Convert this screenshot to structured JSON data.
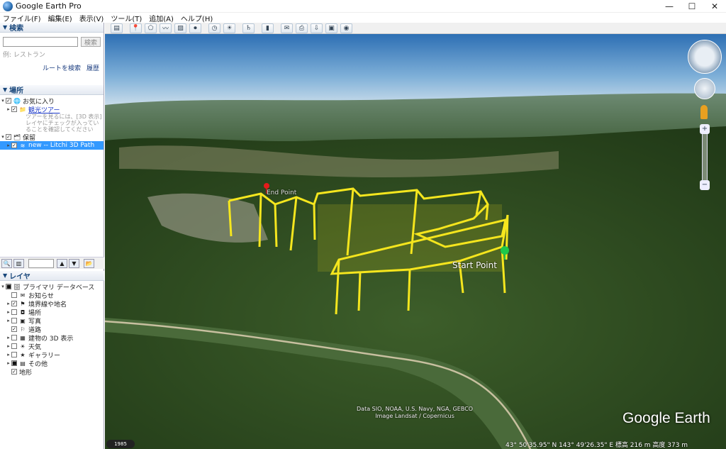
{
  "window": {
    "title": "Google Earth Pro"
  },
  "menu": [
    "ファイル(F)",
    "編集(E)",
    "表示(V)",
    "ツール(T)",
    "追加(A)",
    "ヘルプ(H)"
  ],
  "search": {
    "header": "検索",
    "input_value": "",
    "button": "検索",
    "placeholder": "例: レストラン",
    "route_link": "ルートを検索",
    "history_link": "履歴"
  },
  "places": {
    "header": "場所",
    "items": [
      {
        "label": "お気に入り",
        "checked": true
      },
      {
        "label": "観光ツアー",
        "checked": true
      },
      {
        "label": "保留",
        "checked": true
      },
      {
        "label": "new -- Litchi 3D Path",
        "checked": true
      }
    ],
    "note": "ツアーを見るには、[3D 表示] レイヤにチェックが入っていることを確認してください"
  },
  "layers": {
    "header": "レイヤ",
    "items": [
      {
        "label": "プライマリ データベース",
        "checked": true
      },
      {
        "label": "お知らせ",
        "checked": false
      },
      {
        "label": "境界線や地名",
        "checked": true
      },
      {
        "label": "場所",
        "checked": false
      },
      {
        "label": "写真",
        "checked": false
      },
      {
        "label": "道路",
        "checked": true
      },
      {
        "label": "建物の 3D 表示",
        "checked": false
      },
      {
        "label": "天気",
        "checked": false
      },
      {
        "label": "ギャラリー",
        "checked": false
      },
      {
        "label": "その他",
        "checked": false
      },
      {
        "label": "地形",
        "checked": true
      }
    ]
  },
  "map": {
    "start_label": "Start Point",
    "end_label": "End Point",
    "attribution_1": "Data SIO, NOAA, U.S. Navy, NGA, GEBCO",
    "attribution_2": "Image Landsat / Copernicus",
    "logo": "Google Earth",
    "history_year": "1985",
    "status": "43°  50'35.95\" N  143°  49'26.35\" E  標高  216 m     高度  373 m",
    "path_color": "#f5e61e"
  }
}
